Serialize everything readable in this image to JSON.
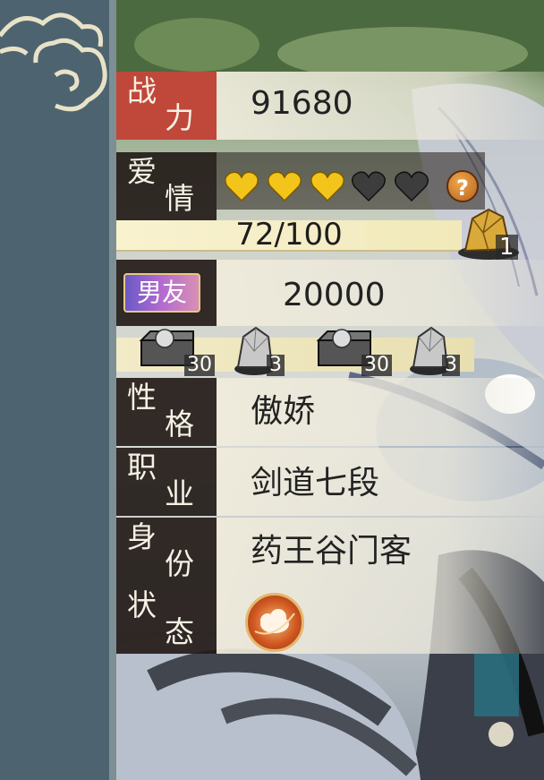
{
  "stats": {
    "power": {
      "label_top": "战",
      "label_bottom": "力",
      "value": "91680"
    },
    "love": {
      "label_top": "爱",
      "label_bottom": "情",
      "hearts_filled": 3,
      "hearts_total": 5,
      "progress_text": "72/100",
      "progress": 0.72,
      "help_symbol": "?",
      "side_reward_count": "1"
    },
    "boyfriend": {
      "badge": "男友",
      "value": "20000"
    },
    "rewards": [
      {
        "icon": "silver-chest-icon",
        "count": "30"
      },
      {
        "icon": "ore-crystal-icon",
        "count": "3"
      },
      {
        "icon": "silver-chest-icon",
        "count": "30"
      },
      {
        "icon": "ore-crystal-icon",
        "count": "3"
      }
    ],
    "personality": {
      "label_top": "性",
      "label_bottom": "格",
      "value": "傲娇"
    },
    "job": {
      "label_top": "职",
      "label_bottom": "业",
      "value": "剑道七段"
    },
    "identity": {
      "label_top": "身",
      "label_bottom": "份",
      "value": "药王谷门客"
    },
    "status": {
      "label_top": "状",
      "label_bottom": "态",
      "icon": "cloud-chain-icon"
    }
  },
  "colors": {
    "power_label_bg": "#c0483a",
    "label_bg": "#2b211d",
    "heart_gold": "#f3c419",
    "heart_gray": "#3d3d3d",
    "sidebar": "#4d6470"
  }
}
